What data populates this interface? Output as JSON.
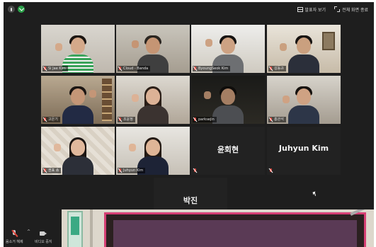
{
  "topbar": {
    "view_label": "발표자 보기",
    "fullscreen_label": "전체 화면 종료"
  },
  "participants": [
    {
      "id": "p1",
      "name": "Si Jae Kim",
      "video": true
    },
    {
      "id": "p2",
      "name": "Cloud - Banda",
      "video": true
    },
    {
      "id": "p3",
      "name": "ByoungSeok Kim",
      "video": true
    },
    {
      "id": "p4",
      "name": "김동규",
      "video": true,
      "active": true
    },
    {
      "id": "p5",
      "name": "고은기",
      "video": true
    },
    {
      "id": "p6",
      "name": "조윤정",
      "video": true
    },
    {
      "id": "p7",
      "name": "parksejin",
      "video": true
    },
    {
      "id": "p8",
      "name": "홍관석",
      "video": true
    },
    {
      "id": "p9",
      "name": "권표 송",
      "video": true
    },
    {
      "id": "p10",
      "name": "Juhyun Kim",
      "video": true
    },
    {
      "id": "p11",
      "name": "윤회현",
      "video": false
    },
    {
      "id": "p12",
      "name": "Juhyun Kim",
      "video": false
    },
    {
      "id": "p13",
      "name": "박진",
      "video": false
    }
  ],
  "toolbar": {
    "unmute_label": "음소거 해제",
    "video_label": "비디오 중지"
  },
  "colors": {
    "background": "#1e1e1e",
    "active_speaker": "#b7d34a",
    "muted": "#e0443a"
  }
}
